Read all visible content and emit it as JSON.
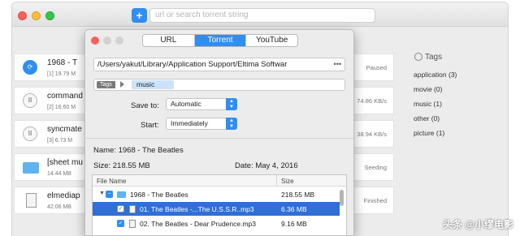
{
  "toolbar": {
    "add_label": "+",
    "search_placeholder": "url or search torrent string"
  },
  "rows": [
    {
      "name": "1968 - T",
      "sub": "[1] 19.79 M",
      "status": "Paused",
      "icon": "refresh-icon"
    },
    {
      "name": "command",
      "sub": "[2] 16.60 M",
      "status": "74.86 KB/s",
      "icon": "pause-icon"
    },
    {
      "name": "syncmate",
      "sub": "[3] 6.73 M",
      "status": "38.94 KB/s",
      "icon": "pause-icon"
    },
    {
      "name": "[sheet mu",
      "sub": "14.44 MB",
      "status": "Seeding",
      "icon": "folder-icon"
    },
    {
      "name": "elmediap",
      "sub": "42.06 MB",
      "status": "Finished",
      "icon": "document-icon"
    }
  ],
  "tags_sidebar": {
    "title": "Tags",
    "items": [
      "application (3)",
      "movie (0)",
      "music (1)",
      "other (0)",
      "picture (1)"
    ]
  },
  "dialog": {
    "tabs": [
      "URL",
      "Torrent",
      "YouTube"
    ],
    "active_tab": "Torrent",
    "path": "/Users/yakut/Library/Application Support/Eltima Softwar",
    "path_more": "•••",
    "tags_label": "Tags",
    "tag_value": "music",
    "save_to_label": "Save to:",
    "save_to_value": "Automatic",
    "start_label": "Start:",
    "start_value": "Immediately",
    "name_line": "Name: 1968 - The Beatles",
    "size_line": "Size: 218.55 MB",
    "date_line": "Date: May 4, 2016",
    "table": {
      "col_name": "File Name",
      "col_size": "Size",
      "rows": [
        {
          "name": "1968 - The Beatles",
          "size": "218.55 MB"
        },
        {
          "name": "01. The Beatles -...The U.S.S.R..mp3",
          "size": "6.36 MB"
        },
        {
          "name": "02. The Beatles - Dear Prudence.mp3",
          "size": "9.16 MB"
        }
      ]
    }
  },
  "watermark": "头条 @小缪电影",
  "colors": {
    "accent": "#2f8ef0",
    "selection": "#2f6fd6"
  }
}
